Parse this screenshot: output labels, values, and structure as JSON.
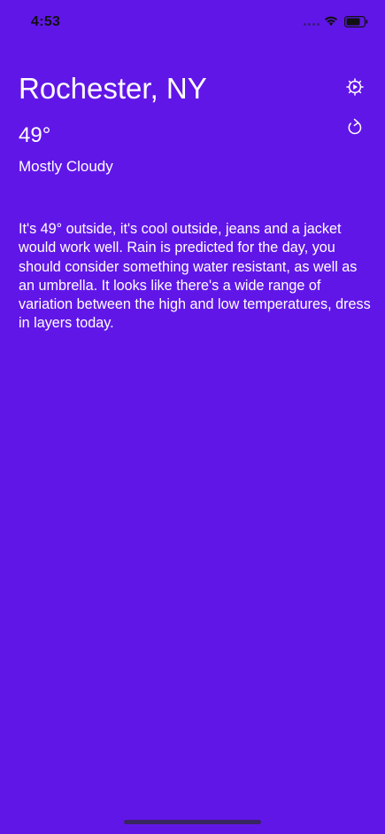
{
  "status_bar": {
    "time": "4:53",
    "icons": [
      "cellular-dots-icon",
      "wifi-icon",
      "battery-icon"
    ]
  },
  "weather": {
    "city": "Rochester, NY",
    "temperature": "49°",
    "condition": "Mostly Cloudy",
    "advice": "It's 49° outside, it's cool outside, jeans and a jacket would work well. Rain is predicted for the day, you should consider something water resistant, as well as an umbrella. It looks like there's a wide range of variation between the high and low temperatures, dress in layers today."
  },
  "actions": {
    "settings_icon": "gear-icon",
    "refresh_icon": "refresh-icon"
  },
  "colors": {
    "background": "#6116e8",
    "text": "#ffffff",
    "status_text": "#111111"
  }
}
